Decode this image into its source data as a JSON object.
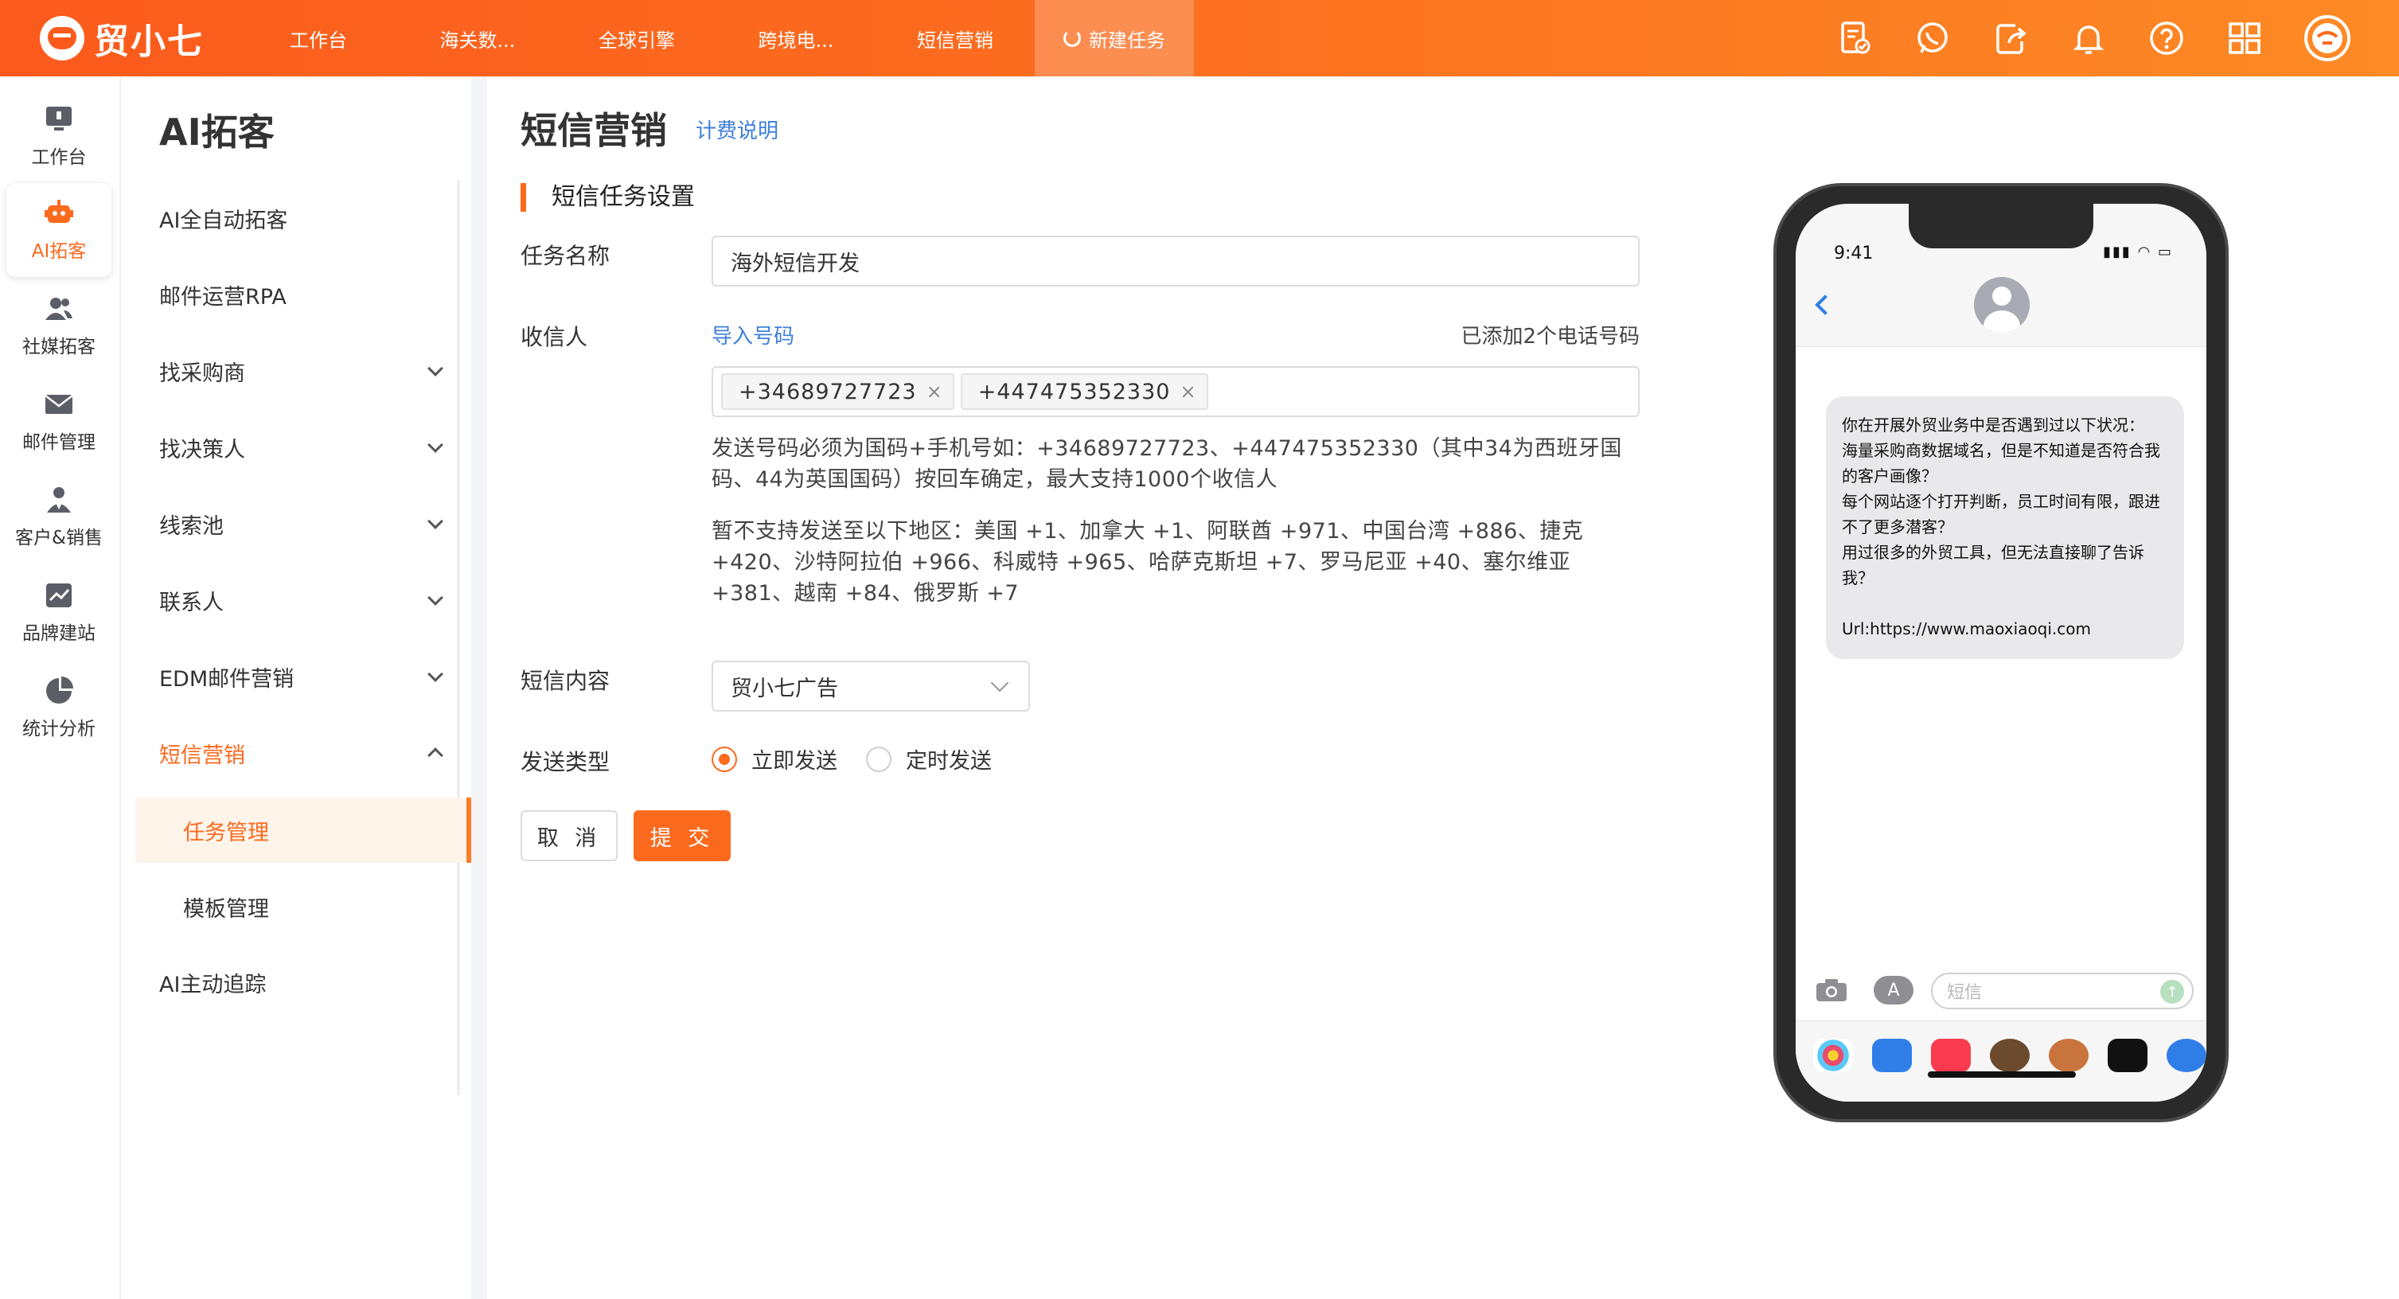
{
  "topbar": {
    "logo_text": "贸小七",
    "nav": [
      "工作台",
      "海关数...",
      "全球引擎",
      "跨境电...",
      "短信营销"
    ],
    "active_tab": "新建任务",
    "icons": [
      "task-icon",
      "whatsapp-icon",
      "share-icon",
      "bell-icon",
      "help-icon",
      "grid-icon",
      "user-avatar-icon"
    ],
    "colors": {
      "brand": "#fc6a1e",
      "link": "#3f7fd8"
    }
  },
  "rail": {
    "items": [
      {
        "label": "工作台",
        "icon": "workbench-icon"
      },
      {
        "label": "AI拓客",
        "icon": "robot-icon"
      },
      {
        "label": "社媒拓客",
        "icon": "social-icon"
      },
      {
        "label": "邮件管理",
        "icon": "mail-icon"
      },
      {
        "label": "客户&销售",
        "icon": "customer-icon"
      },
      {
        "label": "品牌建站",
        "icon": "chart-icon"
      },
      {
        "label": "统计分析",
        "icon": "pie-icon"
      }
    ]
  },
  "menu": {
    "title": "AI拓客",
    "items": [
      {
        "label": "AI全自动拓客"
      },
      {
        "label": "邮件运营RPA"
      },
      {
        "label": "找采购商"
      },
      {
        "label": "找决策人"
      },
      {
        "label": "线索池"
      },
      {
        "label": "联系人"
      },
      {
        "label": "EDM邮件营销"
      },
      {
        "label": "短信营销"
      }
    ],
    "sub_items": [
      "任务管理",
      "模板管理"
    ],
    "last_item": "AI主动追踪"
  },
  "page": {
    "title": "短信营销",
    "billing_link": "计费说明",
    "section_title": "短信任务设置",
    "task_name_label": "任务名称",
    "task_name_value": "海外短信开发",
    "recipient_label": "收信人",
    "import_link": "导入号码",
    "added_count": "已添加2个电话号码",
    "phone_tags": [
      "+34689727723",
      "+447475352330"
    ],
    "tag_close": "×",
    "note1_line1": "发送号码必须为国码+手机号如：+34689727723、+447475352330（其中34为西班牙国",
    "note1_line2": "码、44为英国国码）按回车确定，最大支持1000个收信人",
    "note2_line1": "暂不支持发送至以下地区：美国 +1、加拿大 +1、阿联酋 +971、中国台湾 +886、捷克",
    "note2_line2": "+420、沙特阿拉伯 +966、科威特 +965、哈萨克斯坦 +7、罗马尼亚 +40、塞尔维亚",
    "note2_line3": "+381、越南 +84、俄罗斯 +7",
    "content_label": "短信内容",
    "content_value": "贸小七广告",
    "send_type_label": "发送类型",
    "send_now": "立即发送",
    "send_scheduled": "定时发送",
    "cancel_btn": "取 消",
    "submit_btn": "提 交"
  },
  "phone": {
    "time": "9:41",
    "status": "▮▮▮ ◠ ▭",
    "message_lines": [
      "你在开展外贸业务中是否遇到过以下状况：",
      "海量采购商数据域名，但是不知道是否符合我的客户画像？",
      "每个网站逐个打开判断，员工时间有限，跟进不了更多潜客？",
      "用过很多的外贸工具，但无法直接聊了告诉我？",
      "",
      "Url:https://www.maoxiaoqi.com"
    ],
    "input_placeholder": "短信",
    "appstore_glyph": "A",
    "send_glyph": "↑"
  }
}
